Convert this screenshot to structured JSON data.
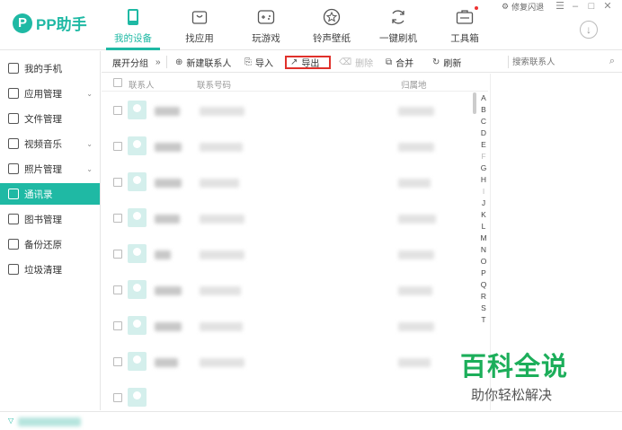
{
  "app": {
    "logo_mark": "P",
    "logo_text": "PP助手",
    "accent_color": "#1fb9a4",
    "export_highlight_color": "#e0312b"
  },
  "window": {
    "repair_label": "修复闪退",
    "menu_glyph": "☰",
    "minimize_glyph": "–",
    "maximize_glyph": "□",
    "close_glyph": "✕",
    "download_glyph": "↓"
  },
  "nav": [
    {
      "label": "我的设备",
      "icon": "phone-icon",
      "active": true
    },
    {
      "label": "找应用",
      "icon": "bag-icon",
      "active": false
    },
    {
      "label": "玩游戏",
      "icon": "gamepad-icon",
      "active": false
    },
    {
      "label": "铃声壁纸",
      "icon": "star-icon",
      "active": false
    },
    {
      "label": "一键刷机",
      "icon": "refresh-icon",
      "active": false
    },
    {
      "label": "工具箱",
      "icon": "toolbox-icon",
      "active": false
    }
  ],
  "sidebar": [
    {
      "label": "我的手机",
      "icon": "phone-icon",
      "chevron": false,
      "active": false
    },
    {
      "label": "应用管理",
      "icon": "app-icon",
      "chevron": true,
      "active": false
    },
    {
      "label": "文件管理",
      "icon": "folder-icon",
      "chevron": false,
      "active": false
    },
    {
      "label": "视频音乐",
      "icon": "play-icon",
      "chevron": true,
      "active": false
    },
    {
      "label": "照片管理",
      "icon": "photo-icon",
      "chevron": true,
      "active": false
    },
    {
      "label": "通讯录",
      "icon": "contacts-icon",
      "chevron": false,
      "active": true
    },
    {
      "label": "图书管理",
      "icon": "book-icon",
      "chevron": false,
      "active": false
    },
    {
      "label": "备份还原",
      "icon": "backup-icon",
      "chevron": false,
      "active": false
    },
    {
      "label": "垃圾清理",
      "icon": "trash-icon",
      "chevron": false,
      "active": false
    }
  ],
  "toolbar": {
    "expand_label": "展开分组",
    "expand_glyph": "»",
    "new_contact_label": "新建联系人",
    "import_label": "导入",
    "export_label": "导出",
    "delete_label": "删除",
    "merge_label": "合并",
    "refresh_label": "刷新",
    "search_placeholder": "搜索联系人"
  },
  "table": {
    "columns": [
      "联系人",
      "联系号码",
      "归属地"
    ]
  },
  "alphabet": [
    "A",
    "B",
    "C",
    "D",
    "E",
    "F",
    "G",
    "H",
    "I",
    "J",
    "K",
    "L",
    "M",
    "N",
    "O",
    "P",
    "Q",
    "R",
    "S",
    "T"
  ],
  "alphabet_dim": [
    "F",
    "I"
  ],
  "watermark": {
    "line1": "百科全说",
    "line2": "助你轻松解决"
  }
}
